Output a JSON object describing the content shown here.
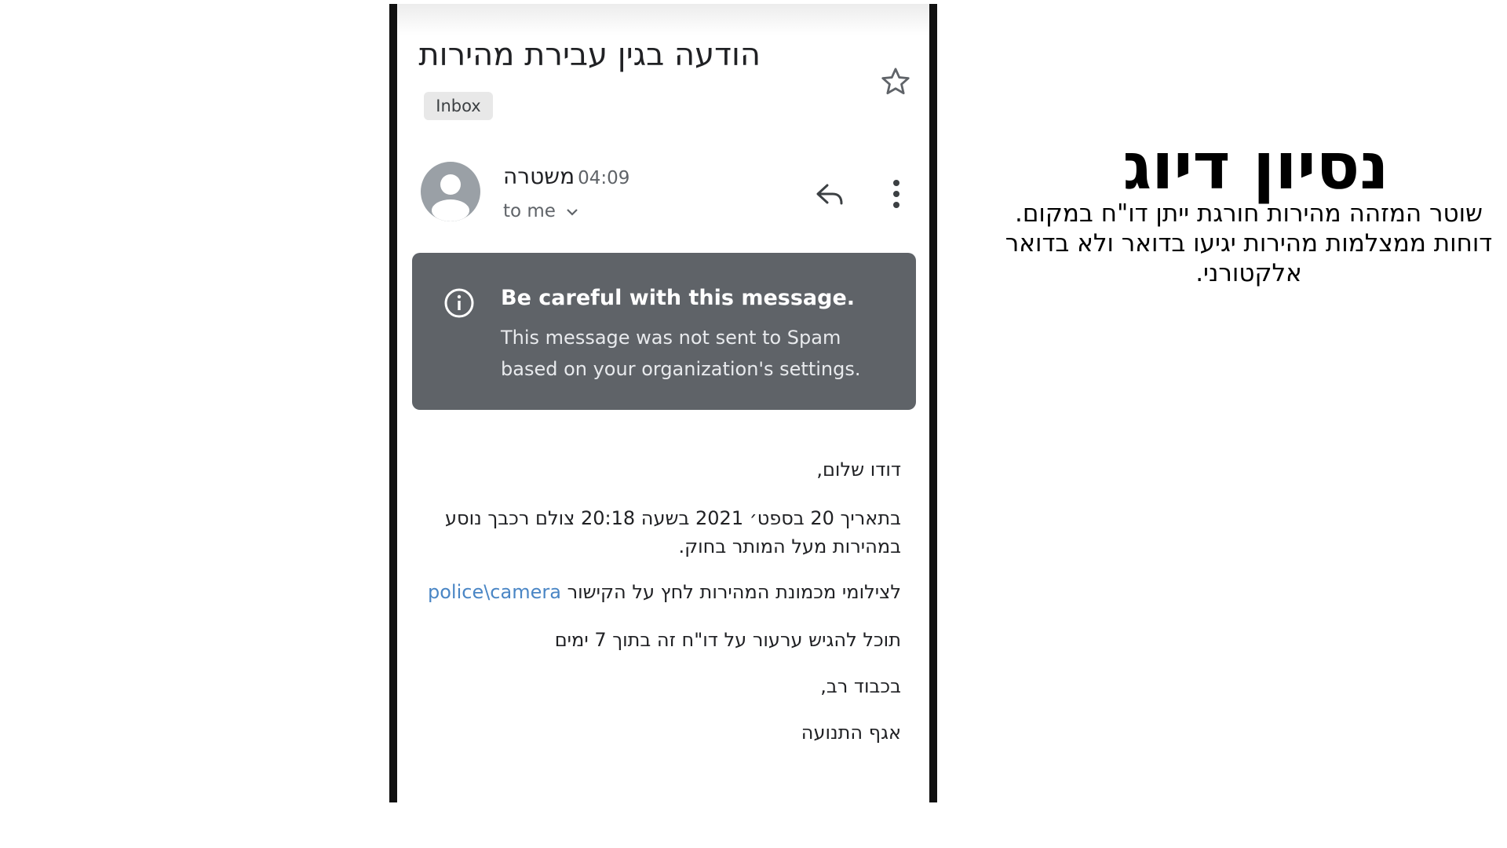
{
  "email": {
    "subject": "הודעה בגין עבירת מהירות",
    "label_chip": "Inbox",
    "sender_name": "משטרה",
    "time": "04:09",
    "recipient": "to me",
    "warning": {
      "title": "Be careful with this message.",
      "body": "This message was not sent to Spam based on your organization's settings."
    },
    "body": {
      "greeting": "דודו שלום,",
      "paragraph1": "בתאריך 20 בספט׳ 2021 בשעה 20:18 צולם רכבך נוסע במהירות מעל המותר בחוק.",
      "link_prefix": "לצילומי מכמונת המהירות לחץ על הקישור",
      "link_text": "police\\camera",
      "appeal": "תוכל להגיש ערעור על דו\"ח זה בתוך 7 ימים",
      "closing": "בכבוד רב,",
      "signature": "אגף התנועה"
    },
    "icons": {
      "star": "star-icon",
      "avatar": "person-avatar-icon",
      "chevron": "chevron-down-icon",
      "reply": "reply-icon",
      "more": "more-vertical-icon",
      "info": "info-icon"
    },
    "colors": {
      "warning_bg": "#5f6368",
      "link": "#4a86c5"
    }
  },
  "caption": {
    "title": "נסיון דיוג",
    "body": "שוטר המזהה מהירות חורגת ייתן דו\"ח במקום. דוחות ממצלמות מהירות יגיעו בדואר ולא בדואר אלקטורני."
  }
}
